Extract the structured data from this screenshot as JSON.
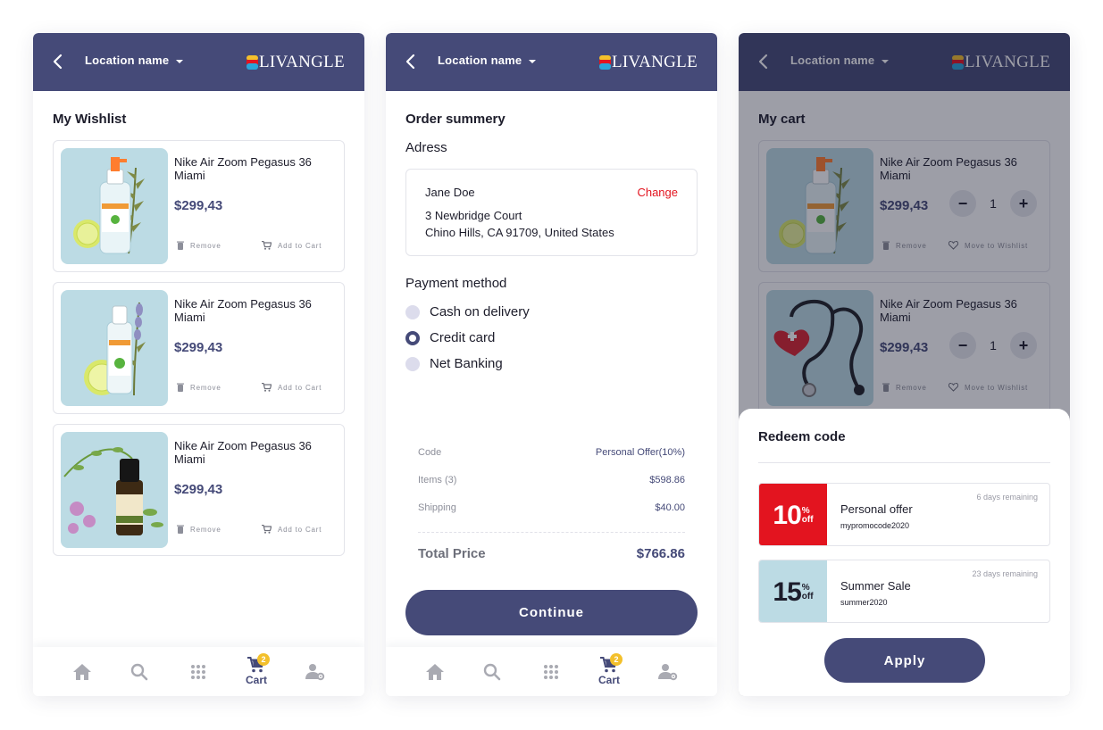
{
  "app": {
    "location_label": "Location name",
    "brand_letter": "O",
    "brand_rest": "LIVANGLE"
  },
  "wishlist": {
    "title": "My Wishlist",
    "items": [
      {
        "name": "Nike Air Zoom Pegasus 36 Miami",
        "price": "$299,43",
        "remove_label": "Remove",
        "add_label": "Add to Cart"
      },
      {
        "name": "Nike Air Zoom Pegasus 36 Miami",
        "price": "$299,43",
        "remove_label": "Remove",
        "add_label": "Add to Cart"
      },
      {
        "name": "Nike Air Zoom Pegasus 36 Miami",
        "price": "$299,43",
        "remove_label": "Remove",
        "add_label": "Add to Cart"
      }
    ]
  },
  "order": {
    "title": "Order summery",
    "address_heading": "Adress",
    "address": {
      "name": "Jane Doe",
      "change_label": "Change",
      "line1": "3 Newbridge Court",
      "line2": "Chino Hills, CA 91709, United States"
    },
    "payment_heading": "Payment method",
    "payment_options": [
      {
        "label": "Cash on delivery",
        "selected": false
      },
      {
        "label": "Credit card",
        "selected": true
      },
      {
        "label": "Net Banking",
        "selected": false
      }
    ],
    "summary": [
      {
        "label": "Code",
        "value": "Personal Offer(10%)"
      },
      {
        "label": "Items (3)",
        "value": "$598.86"
      },
      {
        "label": "Shipping",
        "value": "$40.00"
      }
    ],
    "total_label": "Total Price",
    "total_value": "$766.86",
    "continue_label": "Continue"
  },
  "cart": {
    "title": "My cart",
    "items": [
      {
        "name": "Nike Air Zoom Pegasus 36 Miami",
        "price": "$299,43",
        "qty": "1",
        "remove_label": "Remove",
        "move_label": "Move to Wishlist"
      },
      {
        "name": "Nike Air Zoom Pegasus 36 Miami",
        "price": "$299,43",
        "qty": "1",
        "remove_label": "Remove",
        "move_label": "Move to Wishlist"
      }
    ],
    "redeem": {
      "title": "Redeem code",
      "offers": [
        {
          "amount": "10",
          "pct": "%",
          "off": "off",
          "title": "Personal offer",
          "code": "mypromocode2020",
          "remaining": "6 days remaining",
          "color": "#e3141f"
        },
        {
          "amount": "15",
          "pct": "%",
          "off": "off",
          "title": "Summer Sale",
          "code": "summer2020",
          "remaining": "23 days remaining",
          "color": "#bcdbe4"
        }
      ],
      "apply_label": "Apply"
    }
  },
  "nav": {
    "cart_label": "Cart",
    "cart_badge": "2"
  },
  "colors": {
    "primary": "#454a78",
    "accent_red": "#e3141f",
    "badge": "#f3c02b",
    "thumb_bg": "#bcdbe4"
  }
}
